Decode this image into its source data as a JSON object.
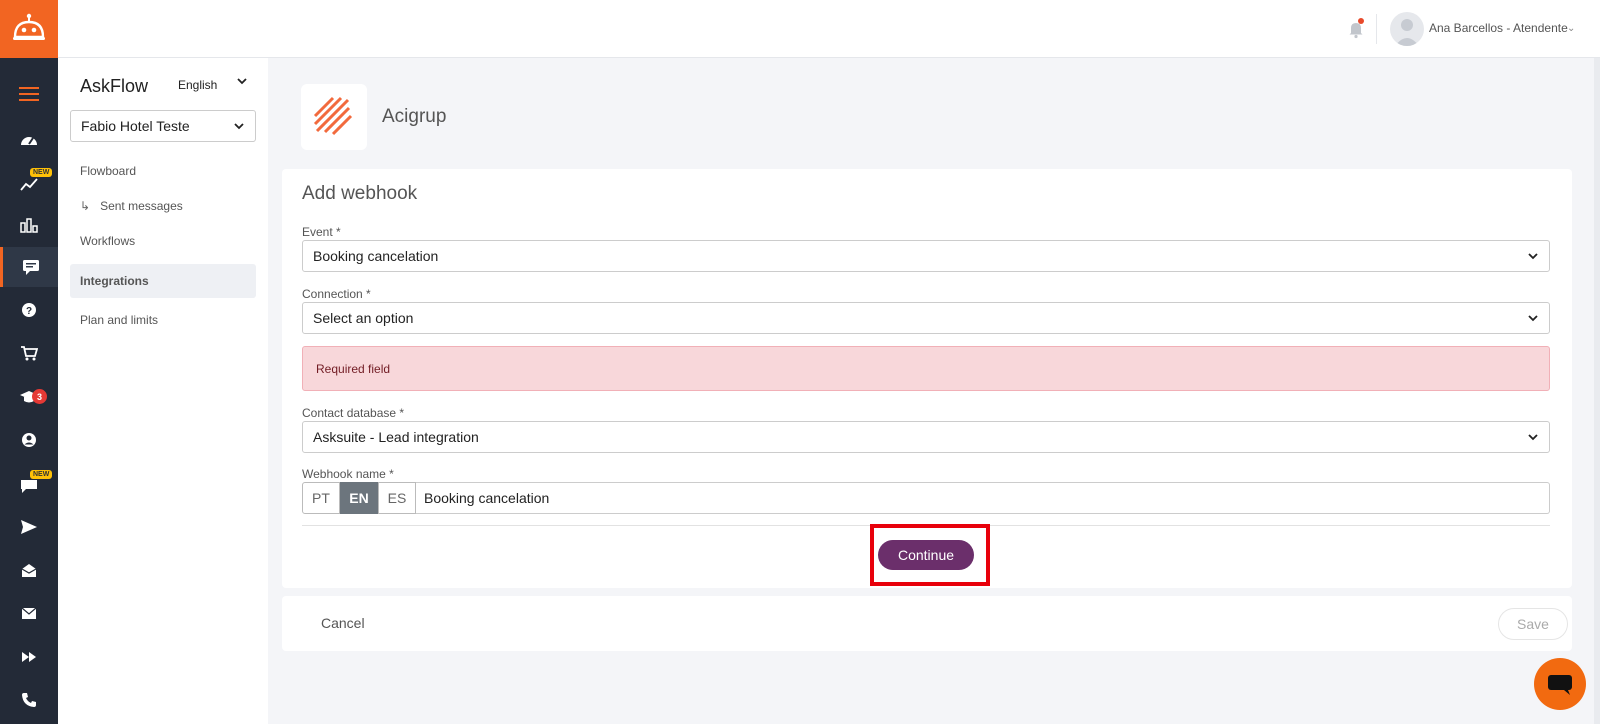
{
  "rail": {
    "new_badge": "NEW",
    "academy_count": "3"
  },
  "topbar": {
    "user_name": "Ana Barcellos - Atendente"
  },
  "sidebar": {
    "brand": "AskFlow",
    "language": "English",
    "hotel": "Fabio Hotel Teste",
    "items": [
      {
        "label": "Flowboard"
      },
      {
        "label": "Sent messages"
      },
      {
        "label": "Workflows"
      },
      {
        "label": "Integrations"
      },
      {
        "label": "Plan and limits"
      }
    ]
  },
  "integration": {
    "name": "Acigrup"
  },
  "form": {
    "title": "Add webhook",
    "event_label": "Event *",
    "event_value": "Booking cancelation",
    "connection_label": "Connection *",
    "connection_value": "Select an option",
    "error_text": "Required field",
    "contact_db_label": "Contact database *",
    "contact_db_value": "Asksuite - Lead integration",
    "webhook_name_label": "Webhook name *",
    "languages": [
      "PT",
      "EN",
      "ES"
    ],
    "selected_language": "EN",
    "webhook_name_value": "Booking cancelation",
    "continue_label": "Continue"
  },
  "footer": {
    "cancel_label": "Cancel",
    "save_label": "Save"
  },
  "colors": {
    "brand_orange": "#f26522",
    "rail_dark": "#232a37",
    "continue_purple": "#6b2f6b",
    "error_bg": "#f8d7da",
    "highlight_red": "#e8000b"
  }
}
